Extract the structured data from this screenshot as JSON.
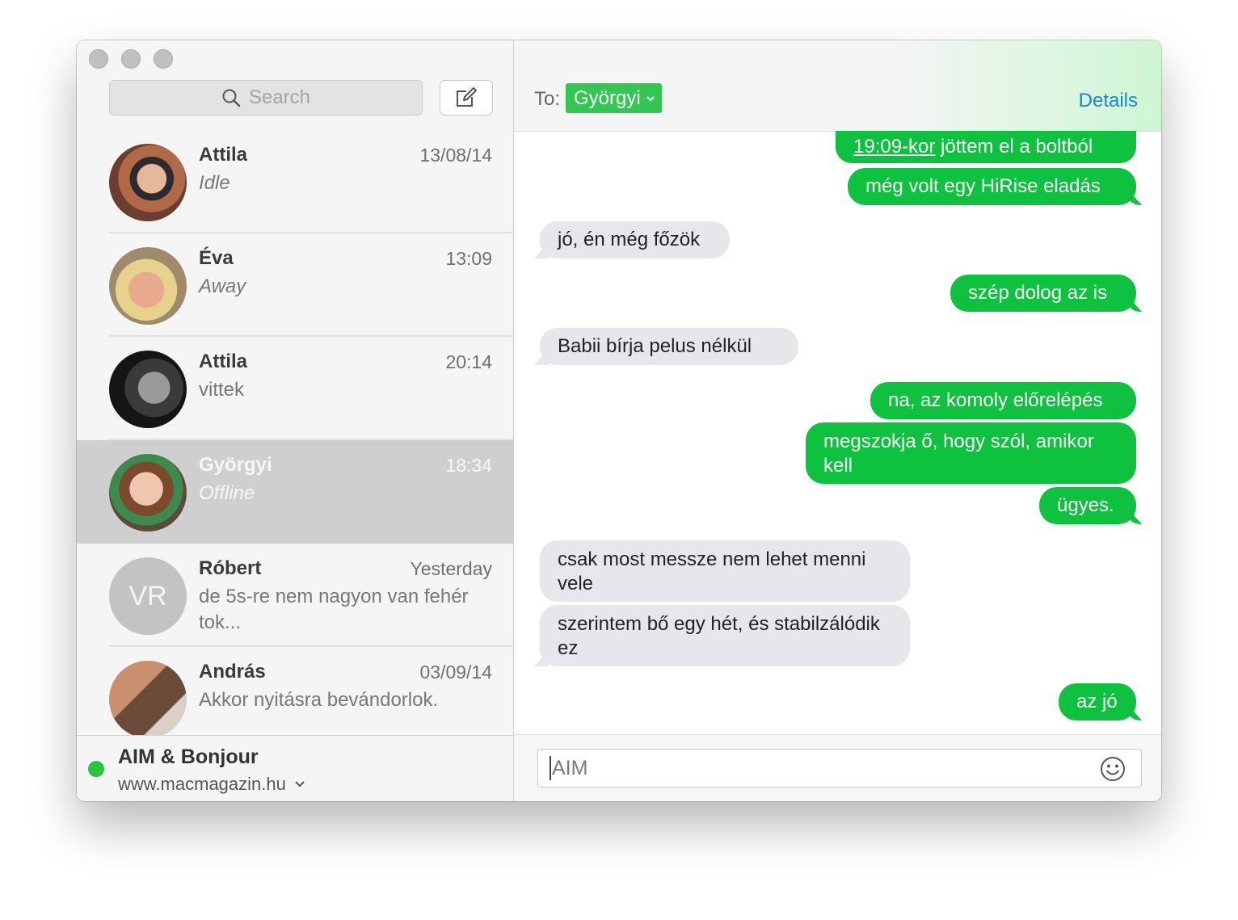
{
  "sidebar": {
    "search_placeholder": "Search",
    "conversations": [
      {
        "name": "Attila",
        "time": "13/08/14",
        "preview": "Idle"
      },
      {
        "name": "Éva",
        "time": "13:09",
        "preview": "Away"
      },
      {
        "name": "Attila",
        "time": "20:14",
        "preview": "vittek"
      },
      {
        "name": "Györgyi",
        "time": "18:34",
        "preview": "Offline"
      },
      {
        "name": "Róbert",
        "time": "Yesterday",
        "preview": "de 5s-re nem nagyon van fehér tok...",
        "initials": "VR"
      },
      {
        "name": "András",
        "time": "03/09/14",
        "preview": "Akkor nyitásra bevándorlok."
      }
    ],
    "footer": {
      "account": "AIM & Bonjour",
      "subtitle": "www.macmagazin.hu"
    }
  },
  "chat": {
    "to_label": "To:",
    "recipient": "Györgyi",
    "details_label": "Details",
    "messages": [
      {
        "dir": "out",
        "link": "19:09-kor",
        "text": " jöttem el a boltból"
      },
      {
        "dir": "out",
        "text": "még volt egy HiRise eladás"
      },
      {
        "dir": "in",
        "text": "jó, én még főzök"
      },
      {
        "dir": "out",
        "text": "szép dolog az is"
      },
      {
        "dir": "in",
        "text": "Babii bírja pelus nélkül"
      },
      {
        "dir": "out",
        "text": "na, az komoly előrelépés"
      },
      {
        "dir": "out",
        "text": "megszokja ő, hogy szól, amikor kell"
      },
      {
        "dir": "out",
        "text": "ügyes."
      },
      {
        "dir": "in",
        "text": "csak most messze nem lehet menni vele"
      },
      {
        "dir": "in",
        "text": "szerintem bő egy hét, és stabilzálódik ez"
      },
      {
        "dir": "out",
        "text": "az jó"
      }
    ],
    "input_placeholder": "AIM"
  },
  "colors": {
    "outgoing_bubble": "#0ec13f",
    "incoming_bubble": "#e6e6eb",
    "recipient_chip": "#33c653",
    "details_link": "#1a84d8",
    "status_online": "#29c440"
  },
  "icons": [
    "search-icon",
    "compose-icon",
    "chevron-down-icon",
    "emoji-icon"
  ]
}
